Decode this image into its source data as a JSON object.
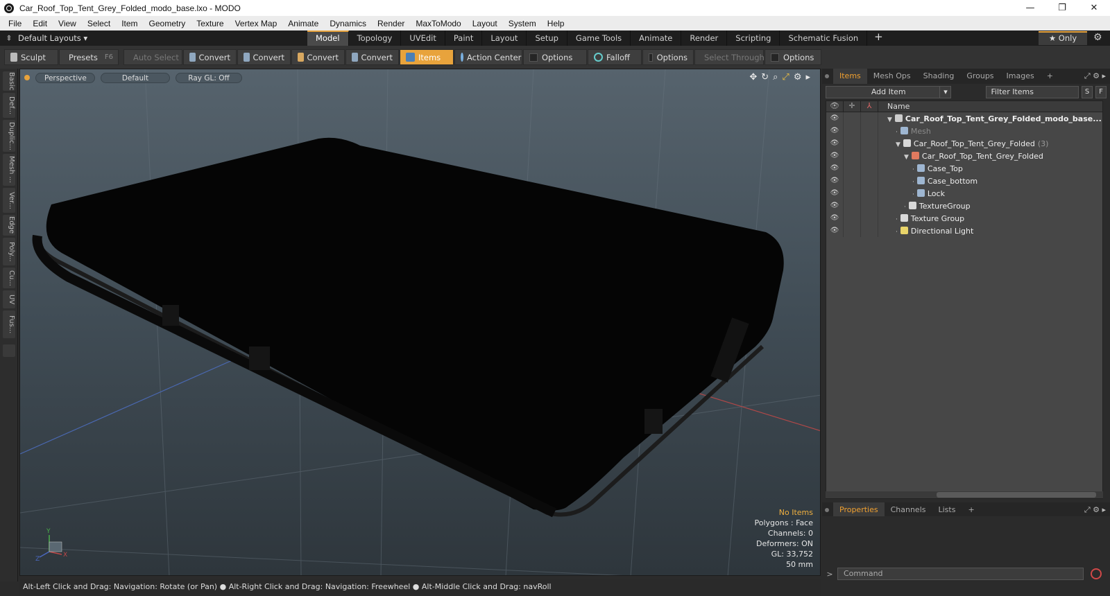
{
  "window": {
    "title": "Car_Roof_Top_Tent_Grey_Folded_modo_base.lxo - MODO",
    "controls": [
      "—",
      "❐",
      "✕"
    ]
  },
  "menu": [
    "File",
    "Edit",
    "View",
    "Select",
    "Item",
    "Geometry",
    "Texture",
    "Vertex Map",
    "Animate",
    "Dynamics",
    "Render",
    "MaxToModo",
    "Layout",
    "System",
    "Help"
  ],
  "layoutbar": {
    "default_layouts": "Default Layouts ▾",
    "tabs": [
      "Model",
      "Topology",
      "UVEdit",
      "Paint",
      "Layout",
      "Setup",
      "Game Tools",
      "Animate",
      "Render",
      "Scripting",
      "Schematic Fusion"
    ],
    "active_tab": "Model",
    "plus": "+",
    "only": "★  Only"
  },
  "toolbar": {
    "sculpt": "Sculpt",
    "presets": "Presets",
    "presets_key": "F6",
    "auto_select": "Auto Select",
    "convert1": "Convert",
    "convert2": "Convert",
    "convert3": "Convert",
    "convert4": "Convert",
    "items": "Items",
    "action_center": "Action Center",
    "options1": "Options",
    "falloff": "Falloff",
    "options2": "Options",
    "select_through": "Select Through",
    "options3": "Options"
  },
  "lefttabs": [
    "Basic",
    "Def...",
    "Duplic...",
    "Mesh ...",
    "Ver...",
    "Edge",
    "Poly...",
    "Cu...",
    "UV",
    "Fus..."
  ],
  "viewport": {
    "view": "Perspective",
    "shading": "Default",
    "raygl": "Ray GL: Off",
    "info": {
      "items": "No Items",
      "polygons": "Polygons : Face",
      "channels": "Channels: 0",
      "deformers": "Deformers: ON",
      "gl": "GL: 33,752",
      "focal": "50 mm"
    },
    "axis_labels": {
      "x": "X",
      "y": "Y",
      "z": "Z"
    }
  },
  "statusbar": "Alt-Left Click and Drag: Navigation: Rotate (or Pan) ● Alt-Right Click and Drag: Navigation: Freewheel ● Alt-Middle Click and Drag: navRoll",
  "panel": {
    "tabs": [
      "Items",
      "Mesh Ops",
      "Shading",
      "Groups",
      "Images"
    ],
    "active_tab": "Items",
    "add_item": "Add Item",
    "filter_placeholder": "Filter Items",
    "s_btn": "S",
    "f_btn": "F",
    "name_col": "Name",
    "tree": [
      {
        "name": "Car_Roof_Top_Tent_Grey_Folded_modo_base...",
        "icon": "scene-icon",
        "level": 0,
        "arrow": "▼",
        "style": "bold"
      },
      {
        "name": "Mesh",
        "icon": "mesh-icon",
        "level": 1,
        "arrow": "",
        "style": "dim"
      },
      {
        "name": "Car_Roof_Top_Tent_Grey_Folded",
        "count": "(3)",
        "icon": "group-icon",
        "level": 1,
        "arrow": "▼",
        "style": ""
      },
      {
        "name": "Car_Roof_Top_Tent_Grey_Folded",
        "icon": "locator-icon",
        "level": 2,
        "arrow": "▼",
        "style": ""
      },
      {
        "name": "Case_Top",
        "icon": "mesh-icon",
        "level": 3,
        "arrow": "",
        "style": ""
      },
      {
        "name": "Case_bottom",
        "icon": "mesh-icon",
        "level": 3,
        "arrow": "",
        "style": ""
      },
      {
        "name": "Lock",
        "icon": "mesh-icon",
        "level": 3,
        "arrow": "",
        "style": ""
      },
      {
        "name": "TextureGroup",
        "icon": "group-icon",
        "level": 2,
        "arrow": "",
        "style": ""
      },
      {
        "name": "Texture Group",
        "icon": "group-icon",
        "level": 1,
        "arrow": "",
        "style": ""
      },
      {
        "name": "Directional Light",
        "icon": "light-icon",
        "level": 1,
        "arrow": "",
        "style": ""
      }
    ],
    "bottom_tabs": [
      "Properties",
      "Channels",
      "Lists"
    ],
    "bottom_active": "Properties",
    "command_placeholder": "Command"
  },
  "colors": {
    "accent": "#e8a33c",
    "viewport_top": "#56636d",
    "viewport_bottom": "#2e363c"
  }
}
